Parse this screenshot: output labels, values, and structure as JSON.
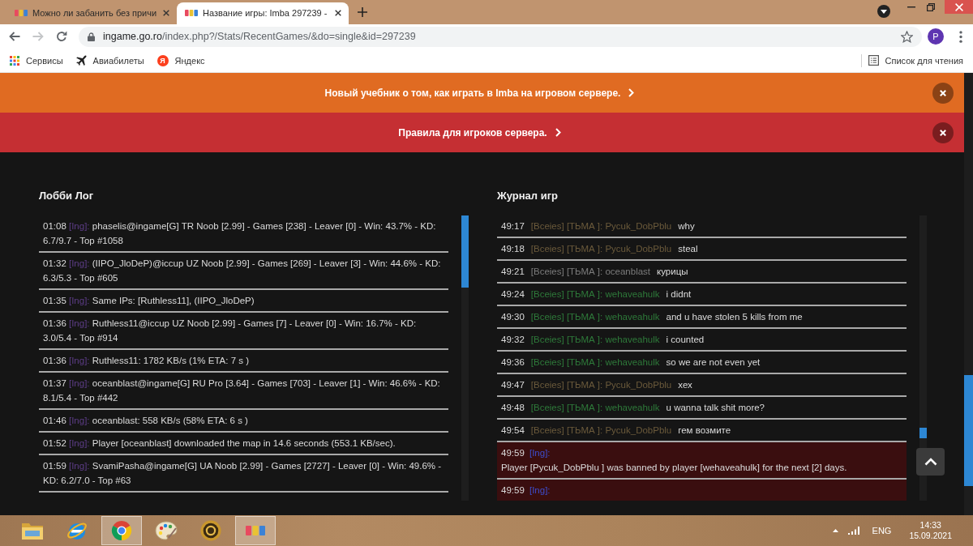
{
  "browser": {
    "tabs": [
      {
        "title": "Можно ли забанить без причи",
        "selected": false
      },
      {
        "title": "Название игры: Imba 297239 -",
        "selected": true
      }
    ],
    "forward_disabled": true,
    "address": {
      "host": "ingame.go.ro",
      "path": "/index.php?/Stats/RecentGames/&do=single&id=297239"
    },
    "profile_initial": "P",
    "bookmarks": [
      {
        "kind": "apps",
        "label": "Сервисы"
      },
      {
        "kind": "plane",
        "label": "Авиабилеты"
      },
      {
        "kind": "badge",
        "badge": "Я",
        "label": "Яндекс"
      }
    ],
    "reading_list": "Список для чтения"
  },
  "banners": [
    {
      "text": "Новый учебник о том, как играть в Imba на игровом сервере.",
      "color": "#e06b22"
    },
    {
      "text": "Правила для игроков сервера.",
      "color": "#c52f33"
    }
  ],
  "lobby_log": {
    "title": "Лобби Лог",
    "rows": [
      {
        "time": "01:08",
        "tag": "[Ing]:",
        "text": "phaselis@ingame[G] TR Noob [2.99] - Games [238] - Leaver [0] - Win: 43.7% - KD: 6.7/9.7 - Top #1058"
      },
      {
        "time": "01:32",
        "tag": "[Ing]:",
        "text": "(IIPO_JloDeP)@iccup UZ Noob [2.99] - Games [269] - Leaver [3] - Win: 44.6% - KD: 6.3/5.3 - Top #605"
      },
      {
        "time": "01:35",
        "tag": "[Ing]:",
        "text": "Same IPs: [Ruthless11], (IIPO_JloDeP)"
      },
      {
        "time": "01:36",
        "tag": "[Ing]:",
        "text": "Ruthless11@iccup UZ Noob [2.99] - Games [7] - Leaver [0] - Win: 16.7% - KD: 3.0/5.4 - Top #914"
      },
      {
        "time": "01:36",
        "tag": "[Ing]:",
        "text": "Ruthless11: 1782 KB/s (1% ETA: 7 s )"
      },
      {
        "time": "01:37",
        "tag": "[Ing]:",
        "text": "oceanblast@ingame[G] RU Pro [3.64] - Games [703] - Leaver [1] - Win: 46.6% - KD: 8.1/5.4 - Top #442"
      },
      {
        "time": "01:46",
        "tag": "[Ing]:",
        "text": "oceanblast: 558 KB/s (58% ETA: 6 s )"
      },
      {
        "time": "01:52",
        "tag": "[Ing]:",
        "text": "Player [oceanblast] downloaded the map in 14.6 seconds (553.1 KB/sec)."
      },
      {
        "time": "01:59",
        "tag": "[Ing]:",
        "text": "SvamiPasha@ingame[G] UA Noob [2.99] - Games [2727] - Leaver [0] - Win: 49.6% - KD: 6.2/7.0 - Top #63"
      }
    ]
  },
  "game_log": {
    "title": "Журнал игр",
    "rows": [
      {
        "kind": "chat",
        "time": "49:17",
        "sender": "[Bceies] [ТЬМА ]: Pycuk_DobPblu",
        "color": "#6b5a3b",
        "text": "why"
      },
      {
        "kind": "chat",
        "time": "49:18",
        "sender": "[Bceies] [ТЬМА ]: Pycuk_DobPblu",
        "color": "#6b5a3b",
        "text": "steal"
      },
      {
        "kind": "chat",
        "time": "49:21",
        "sender": "[Bceies] [ТЬМА ]: oceanblast",
        "color": "#7c7c7c",
        "text": "курицы"
      },
      {
        "kind": "chat",
        "time": "49:24",
        "sender": "[Bceies] [ТЬМА ]: wehaveahulk",
        "color": "#2e7a3a",
        "text": "i didnt"
      },
      {
        "kind": "chat",
        "time": "49:30",
        "sender": "[Bceies] [ТЬМА ]: wehaveahulk",
        "color": "#2e7a3a",
        "text": "and u have stolen 5 kills from me"
      },
      {
        "kind": "chat",
        "time": "49:32",
        "sender": "[Bceies] [ТЬМА ]: wehaveahulk",
        "color": "#2e7a3a",
        "text": "i counted"
      },
      {
        "kind": "chat",
        "time": "49:36",
        "sender": "[Bceies] [ТЬМА ]: wehaveahulk",
        "color": "#2e7a3a",
        "text": "so we are not even yet"
      },
      {
        "kind": "chat",
        "time": "49:47",
        "sender": "[Bceies] [ТЬМА ]: Pycuk_DobPblu",
        "color": "#6b5a3b",
        "text": "хех"
      },
      {
        "kind": "chat",
        "time": "49:48",
        "sender": "[Bceies] [ТЬМА ]: wehaveahulk",
        "color": "#2e7a3a",
        "text": "u wanna talk shit more?"
      },
      {
        "kind": "chat",
        "time": "49:54",
        "sender": "[Bceies] [ТЬМА ]: Pycuk_DobPblu",
        "color": "#6b5a3b",
        "text": "гем возмите"
      },
      {
        "kind": "system",
        "time": "49:59",
        "tag": "[Ing]:",
        "text": "Player [Pycuk_DobPblu ] was banned by player [wehaveahulk] for the next [2] days."
      },
      {
        "kind": "system",
        "time": "49:59",
        "tag": "[Ing]:"
      }
    ]
  },
  "taskbar": {
    "apps": [
      {
        "kind": "folder",
        "highlighted": false
      },
      {
        "kind": "orbit",
        "highlighted": false
      },
      {
        "kind": "wheel",
        "highlighted": true
      },
      {
        "kind": "palette",
        "highlighted": false
      },
      {
        "kind": "emblem",
        "highlighted": false
      },
      {
        "kind": "tiles",
        "highlighted": true
      }
    ],
    "language": "ENG",
    "time": "14:33",
    "date": "15.09.2021"
  }
}
